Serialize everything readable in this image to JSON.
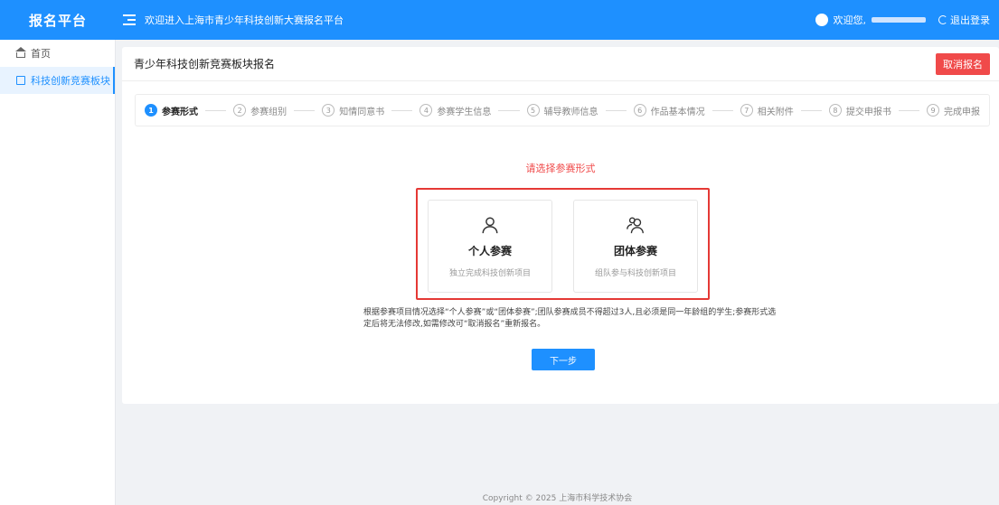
{
  "app": {
    "brand": "报名平台",
    "welcome": "欢迎进入上海市青少年科技创新大赛报名平台"
  },
  "user": {
    "greeting": "欢迎您,",
    "logout_label": "退出登录"
  },
  "sidebar": {
    "items": [
      {
        "label": "首页",
        "icon": "home-icon",
        "active": false
      },
      {
        "label": "科技创新竞赛板块",
        "icon": "document-icon",
        "active": true
      }
    ]
  },
  "panel": {
    "title": "青少年科技创新竞赛板块报名",
    "cancel_label": "取消报名"
  },
  "steps": [
    {
      "num": "1",
      "label": "参赛形式"
    },
    {
      "num": "2",
      "label": "参赛组别"
    },
    {
      "num": "3",
      "label": "知情同意书"
    },
    {
      "num": "4",
      "label": "参赛学生信息"
    },
    {
      "num": "5",
      "label": "辅导教师信息"
    },
    {
      "num": "6",
      "label": "作品基本情况"
    },
    {
      "num": "7",
      "label": "相关附件"
    },
    {
      "num": "8",
      "label": "提交申报书"
    },
    {
      "num": "9",
      "label": "完成申报"
    }
  ],
  "form": {
    "prompt": "请选择参赛形式",
    "personal": {
      "title": "个人参赛",
      "desc": "独立完成科技创新项目"
    },
    "team": {
      "title": "团体参赛",
      "desc": "组队参与科技创新项目"
    },
    "note": "根据参赛项目情况选择“个人参赛”或“团体参赛”;团队参赛成员不得超过3人,且必须是同一年龄组的学生;参赛形式选定后将无法修改,如需修改可“取消报名”重新报名。",
    "next_label": "下一步"
  },
  "footer": {
    "text": "Copyright © 2025 上海市科学技术协会"
  },
  "colors": {
    "primary": "#1e90ff",
    "danger": "#f04a4a"
  }
}
